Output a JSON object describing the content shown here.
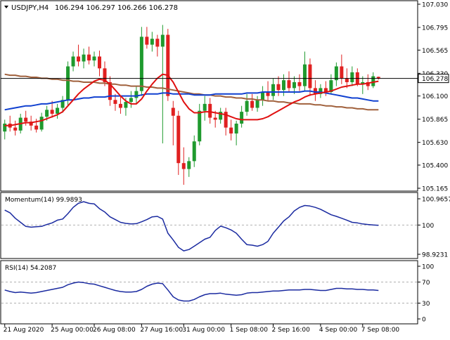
{
  "colors": {
    "bull": "#1f9a2e",
    "bear": "#e02020",
    "ma_fast": "#e01010",
    "ma_mid": "#1040d0",
    "ma_slow": "#a0603c",
    "osc": "#1a2aa0",
    "grid": "#b0b0b0",
    "frame": "#000000",
    "price_tag_bg": "#ffffff",
    "price_line": "#000000"
  },
  "header": {
    "symbol_tf": "USDJPY,H4",
    "ohlc": "106.294 106.297 106.266 106.278"
  },
  "momentum": {
    "label": "Momentum(14) 99.9893"
  },
  "rsi": {
    "label": "RSI(14) 54.2087"
  },
  "chart_data": [
    {
      "type": "line",
      "panel": "price",
      "title": "USDJPY,H4",
      "subtitle": "106.294 106.297 106.266 106.278",
      "y_ticks": [
        "107.030",
        "106.795",
        "106.565",
        "106.330",
        "106.100",
        "105.865",
        "105.630",
        "105.400",
        "105.165"
      ],
      "ylim": [
        105.165,
        107.03
      ],
      "current_price": "106.278",
      "candles": [
        [
          105.74,
          105.86,
          105.66,
          105.82
        ],
        [
          105.82,
          105.9,
          105.74,
          105.78
        ],
        [
          105.78,
          105.85,
          105.7,
          105.75
        ],
        [
          105.75,
          105.92,
          105.72,
          105.88
        ],
        [
          105.88,
          105.95,
          105.8,
          105.84
        ],
        [
          105.84,
          105.9,
          105.75,
          105.8
        ],
        [
          105.8,
          105.87,
          105.73,
          105.76
        ],
        [
          105.76,
          105.93,
          105.74,
          105.89
        ],
        [
          105.89,
          106.0,
          105.85,
          105.96
        ],
        [
          105.96,
          106.05,
          105.88,
          105.92
        ],
        [
          105.92,
          106.02,
          105.87,
          105.98
        ],
        [
          105.98,
          106.1,
          105.93,
          106.06
        ],
        [
          106.06,
          106.45,
          106.0,
          106.4
        ],
        [
          106.4,
          106.55,
          106.35,
          106.5
        ],
        [
          106.5,
          106.62,
          106.4,
          106.45
        ],
        [
          106.45,
          106.58,
          106.38,
          106.52
        ],
        [
          106.52,
          106.6,
          106.42,
          106.46
        ],
        [
          106.46,
          106.55,
          106.4,
          106.5
        ],
        [
          106.5,
          106.56,
          106.3,
          106.38
        ],
        [
          106.38,
          106.45,
          106.2,
          106.24
        ],
        [
          106.24,
          106.3,
          106.0,
          106.06
        ],
        [
          106.06,
          106.12,
          105.95,
          106.02
        ],
        [
          106.02,
          106.1,
          105.92,
          105.98
        ],
        [
          105.98,
          106.08,
          105.9,
          106.04
        ],
        [
          106.04,
          106.15,
          105.98,
          106.08
        ],
        [
          106.08,
          106.2,
          106.02,
          106.15
        ],
        [
          106.15,
          106.8,
          106.1,
          106.7
        ],
        [
          106.7,
          106.8,
          106.58,
          106.62
        ],
        [
          106.62,
          106.75,
          106.55,
          106.68
        ],
        [
          106.68,
          106.72,
          106.5,
          106.6
        ],
        [
          106.6,
          106.82,
          105.62,
          106.72
        ],
        [
          106.72,
          106.78,
          106.05,
          106.1
        ],
        [
          105.98,
          106.05,
          105.6,
          105.9
        ],
        [
          105.9,
          105.95,
          105.3,
          105.42
        ],
        [
          105.42,
          105.58,
          105.2,
          105.36
        ],
        [
          105.36,
          105.48,
          105.28,
          105.44
        ],
        [
          105.44,
          105.7,
          105.38,
          105.64
        ],
        [
          105.64,
          106.02,
          105.6,
          105.95
        ],
        [
          105.95,
          106.1,
          105.85,
          106.02
        ],
        [
          106.02,
          106.08,
          105.82,
          105.88
        ],
        [
          105.88,
          105.95,
          105.78,
          105.86
        ],
        [
          105.86,
          105.98,
          105.82,
          105.94
        ],
        [
          105.94,
          105.98,
          105.7,
          105.78
        ],
        [
          105.78,
          105.86,
          105.65,
          105.72
        ],
        [
          105.72,
          105.85,
          105.6,
          105.82
        ],
        [
          105.82,
          106.0,
          105.78,
          105.94
        ],
        [
          105.94,
          106.12,
          105.9,
          106.05
        ],
        [
          106.05,
          106.12,
          105.95,
          105.98
        ],
        [
          105.98,
          106.1,
          105.94,
          106.06
        ],
        [
          106.06,
          106.2,
          106.0,
          106.14
        ],
        [
          106.14,
          106.25,
          106.05,
          106.1
        ],
        [
          106.1,
          106.28,
          106.06,
          106.22
        ],
        [
          106.22,
          106.3,
          106.1,
          106.16
        ],
        [
          106.16,
          106.32,
          106.1,
          106.26
        ],
        [
          106.26,
          106.35,
          106.14,
          106.18
        ],
        [
          106.18,
          106.3,
          106.12,
          106.24
        ],
        [
          106.24,
          106.32,
          106.15,
          106.2
        ],
        [
          106.2,
          106.55,
          106.15,
          106.42
        ],
        [
          106.42,
          106.48,
          106.1,
          106.18
        ],
        [
          106.18,
          106.26,
          106.05,
          106.12
        ],
        [
          106.12,
          106.22,
          106.08,
          106.18
        ],
        [
          106.18,
          106.25,
          106.1,
          106.14
        ],
        [
          106.14,
          106.32,
          106.12,
          106.26
        ],
        [
          106.26,
          106.44,
          106.2,
          106.4
        ],
        [
          106.4,
          106.52,
          106.22,
          106.28
        ],
        [
          106.28,
          106.38,
          106.18,
          106.24
        ],
        [
          106.24,
          106.4,
          106.2,
          106.34
        ],
        [
          106.34,
          106.38,
          106.2,
          106.22
        ],
        [
          106.22,
          106.3,
          106.12,
          106.24
        ],
        [
          106.24,
          106.32,
          106.16,
          106.2
        ],
        [
          106.2,
          106.34,
          106.18,
          106.3
        ],
        [
          106.294,
          106.297,
          106.266,
          106.278
        ]
      ],
      "ma_fast": [
        105.8,
        105.8,
        105.81,
        105.82,
        105.83,
        105.83,
        105.84,
        105.85,
        105.87,
        105.89,
        105.91,
        105.94,
        106.0,
        106.06,
        106.12,
        106.17,
        106.21,
        106.25,
        106.27,
        106.26,
        106.22,
        106.16,
        106.1,
        106.05,
        106.02,
        106.02,
        106.07,
        106.15,
        106.22,
        106.28,
        106.32,
        106.31,
        106.24,
        106.14,
        106.04,
        105.97,
        105.93,
        105.93,
        105.94,
        105.94,
        105.93,
        105.92,
        105.91,
        105.89,
        105.87,
        105.86,
        105.86,
        105.86,
        105.86,
        105.87,
        105.89,
        105.92,
        105.95,
        105.98,
        106.01,
        106.04,
        106.06,
        106.09,
        106.11,
        106.12,
        106.13,
        106.14,
        106.15,
        106.17,
        106.19,
        106.2,
        106.21,
        106.22,
        106.22,
        106.23,
        106.24,
        106.25
      ],
      "ma_mid": [
        105.96,
        105.97,
        105.98,
        105.99,
        106.0,
        106.0,
        106.01,
        106.02,
        106.02,
        106.03,
        106.04,
        106.05,
        106.06,
        106.06,
        106.07,
        106.08,
        106.08,
        106.09,
        106.09,
        106.09,
        106.1,
        106.1,
        106.1,
        106.1,
        106.1,
        106.1,
        106.11,
        106.12,
        106.12,
        106.12,
        106.13,
        106.13,
        106.12,
        106.12,
        106.12,
        106.12,
        106.11,
        106.11,
        106.11,
        106.11,
        106.12,
        106.12,
        106.12,
        106.12,
        106.12,
        106.12,
        106.13,
        106.13,
        106.13,
        106.14,
        106.14,
        106.14,
        106.14,
        106.14,
        106.14,
        106.14,
        106.14,
        106.15,
        106.15,
        106.14,
        106.14,
        106.13,
        106.12,
        106.11,
        106.1,
        106.09,
        106.08,
        106.08,
        106.07,
        106.06,
        106.05,
        106.05
      ],
      "ma_slow": [
        106.32,
        106.31,
        106.31,
        106.3,
        106.3,
        106.29,
        106.29,
        106.28,
        106.28,
        106.27,
        106.27,
        106.26,
        106.26,
        106.25,
        106.25,
        106.24,
        106.24,
        106.24,
        106.23,
        106.23,
        106.22,
        106.22,
        106.21,
        106.21,
        106.2,
        106.2,
        106.2,
        106.19,
        106.19,
        106.18,
        106.18,
        106.17,
        106.16,
        106.15,
        106.14,
        106.13,
        106.12,
        106.12,
        106.11,
        106.11,
        106.1,
        106.1,
        106.09,
        106.09,
        106.08,
        106.08,
        106.07,
        106.07,
        106.06,
        106.06,
        106.05,
        106.05,
        106.04,
        106.04,
        106.03,
        106.03,
        106.02,
        106.02,
        106.02,
        106.01,
        106.01,
        106.0,
        106.0,
        105.99,
        105.99,
        105.98,
        105.98,
        105.97,
        105.97,
        105.96,
        105.96,
        105.96
      ]
    },
    {
      "type": "line",
      "panel": "momentum",
      "title": "Momentum(14) 99.9893",
      "y_ticks": [
        "100.9657",
        "100",
        "98.9231"
      ],
      "ylim": [
        98.9231,
        100.9657
      ],
      "values": [
        100.55,
        100.45,
        100.25,
        100.1,
        99.95,
        99.92,
        99.94,
        99.95,
        100.02,
        100.08,
        100.18,
        100.22,
        100.42,
        100.65,
        100.8,
        100.86,
        100.8,
        100.78,
        100.6,
        100.48,
        100.3,
        100.2,
        100.1,
        100.06,
        100.04,
        100.05,
        100.12,
        100.2,
        100.3,
        100.32,
        100.22,
        99.7,
        99.45,
        99.18,
        99.05,
        99.1,
        99.22,
        99.35,
        99.48,
        99.55,
        99.8,
        99.96,
        99.9,
        99.82,
        99.7,
        99.48,
        99.28,
        99.26,
        99.22,
        99.28,
        99.4,
        99.7,
        99.92,
        100.15,
        100.3,
        100.52,
        100.65,
        100.72,
        100.7,
        100.65,
        100.58,
        100.48,
        100.38,
        100.32,
        100.25,
        100.18,
        100.1,
        100.08,
        100.04,
        100.02,
        100.0,
        99.99
      ]
    },
    {
      "type": "line",
      "panel": "rsi",
      "title": "RSI(14) 54.2087",
      "y_ticks": [
        "100",
        "70",
        "30",
        "0"
      ],
      "ylim": [
        0,
        100
      ],
      "levels": [
        70,
        30
      ],
      "values": [
        55,
        52,
        50,
        51,
        50,
        49,
        50,
        52,
        54,
        56,
        58,
        60,
        65,
        68,
        70,
        69,
        67,
        66,
        63,
        60,
        57,
        54,
        52,
        51,
        51,
        52,
        56,
        62,
        66,
        68,
        67,
        55,
        42,
        36,
        34,
        34,
        37,
        42,
        46,
        48,
        48,
        49,
        47,
        46,
        45,
        46,
        49,
        50,
        50,
        51,
        52,
        53,
        53,
        54,
        55,
        55,
        55,
        56,
        56,
        55,
        54,
        54,
        56,
        58,
        58,
        57,
        57,
        56,
        56,
        55,
        55,
        54
      ]
    }
  ],
  "x_axis": {
    "labels": [
      "21 Aug 2020",
      "25 Aug 00:00",
      "26 Aug 08:00",
      "27 Aug 16:00",
      "31 Aug 00:00",
      "1 Sep 08:00",
      "2 Sep 16:00",
      "4 Sep 00:00",
      "7 Sep 08:00"
    ]
  }
}
